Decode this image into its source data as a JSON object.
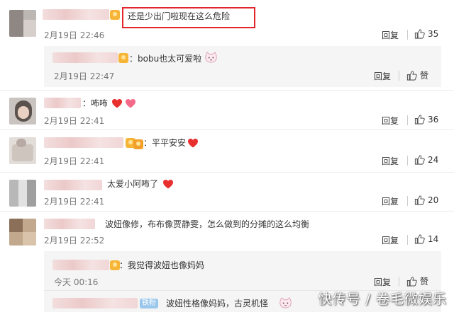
{
  "comments": [
    {
      "text": "还是少出门啦现在这么危险",
      "time": "2月19日 22:46",
      "reply": "回复",
      "likes": "35"
    },
    {
      "text": "：bobu也太可爱啦",
      "time": "2月19日 22:47",
      "reply": "回复",
      "likes": "赞"
    },
    {
      "text": "：咘咘",
      "time": "2月19日 22:41",
      "reply": "回复",
      "likes": "36"
    },
    {
      "text": "：平平安安",
      "time": "2月19日 22:41",
      "reply": "回复",
      "likes": "24"
    },
    {
      "text": "太爱小阿咘了",
      "time": "2月19日 22:41",
      "reply": "回复",
      "likes": "20"
    },
    {
      "text": "波妞像修，布布像贾静雯，怎么做到的分摊的这么均衡",
      "time": "2月19日 22:52",
      "reply": "回复",
      "likes": "14"
    },
    {
      "text": "：我觉得波妞也像妈妈",
      "time": "今天 00:16",
      "reply": "回复",
      "likes": "赞"
    },
    {
      "text": "波妞性格像妈妈，古灵机怪"
    }
  ],
  "badge": {
    "fans": "铁粉"
  },
  "colors": {
    "highlight": "#e3262d",
    "heart": "#e8302f",
    "fan_badge": "#9ac7ec"
  },
  "icons": {
    "like": "thumbs-up-icon",
    "vip": "crown-icon",
    "emoji_heart": "heart-icon",
    "emoji_cat": "cat-face-icon"
  },
  "watermark": "快传号 / 卷毛微娱乐"
}
